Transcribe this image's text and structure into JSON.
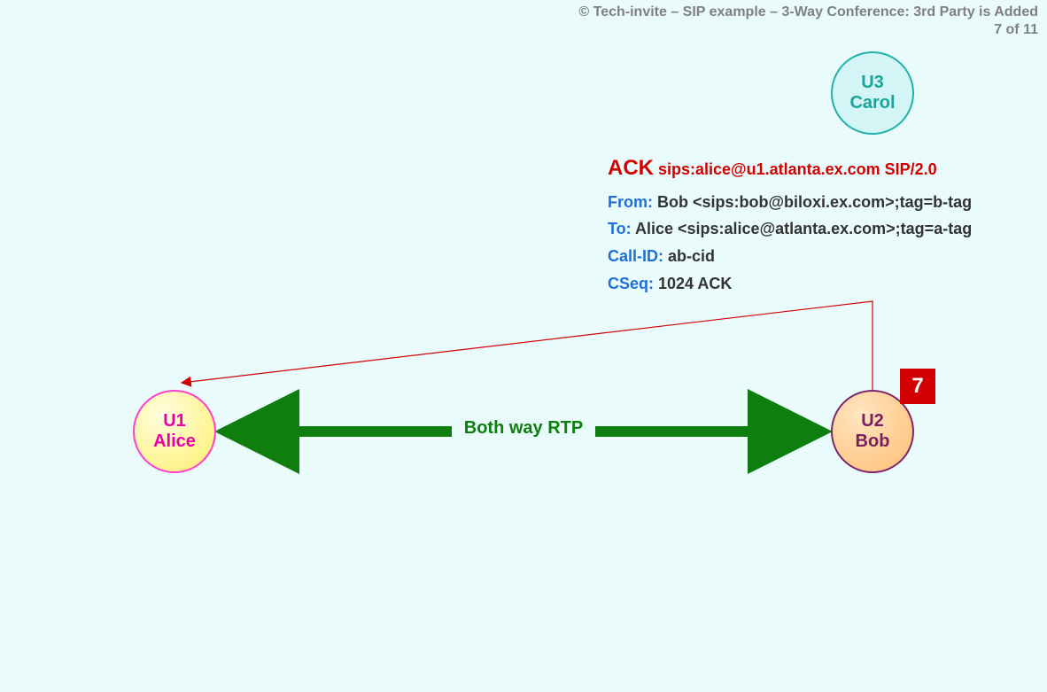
{
  "header": {
    "copyright": "© Tech-invite – SIP example – 3-Way Conference: 3rd Party is Added",
    "slide": "7 of 11"
  },
  "step_badge": "7",
  "nodes": {
    "u1": {
      "id": "U1",
      "name": "Alice"
    },
    "u2": {
      "id": "U2",
      "name": "Bob"
    },
    "u3": {
      "id": "U3",
      "name": "Carol"
    }
  },
  "media_label": "Both way RTP",
  "sip": {
    "method": "ACK",
    "request_rest": " sips:alice@u1.atlanta.ex.com SIP/2.0",
    "from_label": "From:",
    "from_value": " Bob <sips:bob@biloxi.ex.com>;tag=b-tag",
    "to_label": "To:",
    "to_value": " Alice <sips:alice@atlanta.ex.com>;tag=a-tag",
    "callid_label": "Call-ID:",
    "callid_value": " ab-cid",
    "cseq_label": "CSeq:",
    "cseq_value": " 1024 ACK"
  }
}
